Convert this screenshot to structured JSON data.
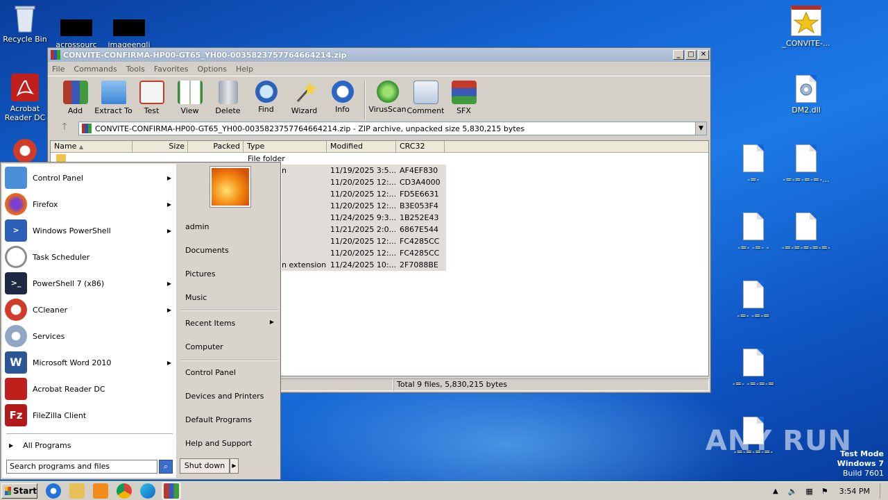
{
  "desktop": {
    "icons": [
      {
        "label": "Recycle Bin"
      },
      {
        "label": "acrossourc"
      },
      {
        "label": "imageengli"
      },
      {
        "label": "Acrobat Reader DC"
      },
      {
        "label": "_CONVITE-..."
      },
      {
        "label": "DM2.dll"
      },
      {
        "label": "-=-"
      },
      {
        "label": "-=-=-=-=-..."
      },
      {
        "label": "-=- -=- -"
      },
      {
        "label": "-=-=-=-=-=-"
      },
      {
        "label": "-=- -=-="
      },
      {
        "label": "-=- -=-=-="
      },
      {
        "label": "-=-=-=-=-"
      }
    ],
    "watermark": "ANY RUN",
    "test_mode": {
      "line1": "Test Mode",
      "line2": "Windows 7",
      "line3": "Build 7601"
    }
  },
  "winrar": {
    "title": "CONVITE-CONFIRMA-HP00-GT65_YH00-0035823757764664214.zip",
    "menu": [
      "File",
      "Commands",
      "Tools",
      "Favorites",
      "Options",
      "Help"
    ],
    "toolbar": [
      {
        "label": "Add",
        "icon": "add-icon"
      },
      {
        "label": "Extract To",
        "icon": "extract-folder-icon"
      },
      {
        "label": "Test",
        "icon": "test-clipboard-icon"
      },
      {
        "label": "View",
        "icon": "book-icon"
      },
      {
        "label": "Delete",
        "icon": "trash-icon"
      },
      {
        "label": "Find",
        "icon": "magnifier-icon"
      },
      {
        "label": "Wizard",
        "icon": "wand-icon"
      },
      {
        "label": "Info",
        "icon": "info-icon"
      },
      {
        "label": "VirusScan",
        "icon": "bug-icon"
      },
      {
        "label": "Comment",
        "icon": "comment-icon"
      },
      {
        "label": "SFX",
        "icon": "sfx-books-icon"
      }
    ],
    "address": "CONVITE-CONFIRMA-HP00-GT65_YH00-0035823757764664214.zip - ZIP archive, unpacked size 5,830,215 bytes",
    "columns": [
      "Name",
      "Size",
      "Packed",
      "Type",
      "Modified",
      "CRC32"
    ],
    "rows": [
      {
        "type": "File folder",
        "modified": "",
        "crc": ""
      },
      {
        "type": "n",
        "modified": "11/19/2025 3:5...",
        "crc": "AF4EF830"
      },
      {
        "type": "",
        "modified": "11/20/2025 12:...",
        "crc": "CD3A4000"
      },
      {
        "type": "",
        "modified": "11/20/2025 12:...",
        "crc": "FD5E6631"
      },
      {
        "type": "",
        "modified": "11/20/2025 12:...",
        "crc": "B3E053F4"
      },
      {
        "type": "",
        "modified": "11/24/2025 9:3...",
        "crc": "1B252E43"
      },
      {
        "type": "",
        "modified": "11/21/2025 2:0...",
        "crc": "6867E544"
      },
      {
        "type": "",
        "modified": "11/20/2025 12:...",
        "crc": "FC4285CC"
      },
      {
        "type": "",
        "modified": "11/20/2025 12:...",
        "crc": "FC4285CC"
      },
      {
        "type": "n extension",
        "modified": "11/24/2025 10:...",
        "crc": "2F7088BE"
      }
    ],
    "status_total": "Total 9 files, 5,830,215 bytes"
  },
  "start_menu": {
    "programs": [
      {
        "label": "Control Panel",
        "icon": "control-panel-icon",
        "color": "#4a8fd8",
        "arrow": true
      },
      {
        "label": "Firefox",
        "icon": "firefox-icon",
        "color": "#e8681c",
        "arrow": true
      },
      {
        "label": "Windows PowerShell",
        "icon": "powershell-icon",
        "color": "#2b5fb8",
        "arrow": true
      },
      {
        "label": "Task Scheduler",
        "icon": "clock-icon",
        "color": "#d9d9d9",
        "arrow": false
      },
      {
        "label": "PowerShell 7 (x86)",
        "icon": "powershell7-icon",
        "color": "#1e2a44",
        "arrow": true
      },
      {
        "label": "CCleaner",
        "icon": "ccleaner-icon",
        "color": "#d23b2a",
        "arrow": true
      },
      {
        "label": "Services",
        "icon": "services-gear-icon",
        "color": "#8fa7c4",
        "arrow": false
      },
      {
        "label": "Microsoft Word 2010",
        "icon": "word-icon",
        "color": "#2b5797",
        "arrow": true
      },
      {
        "label": "Acrobat Reader DC",
        "icon": "acrobat-icon",
        "color": "#c0201d",
        "arrow": false
      },
      {
        "label": "FileZilla Client",
        "icon": "filezilla-icon",
        "color": "#b3181a",
        "arrow": false
      }
    ],
    "all_programs": "All Programs",
    "search_placeholder": "Search programs and files",
    "right": {
      "user": "admin",
      "documents": "Documents",
      "pictures": "Pictures",
      "music": "Music",
      "recent": "Recent Items",
      "computer": "Computer",
      "control_panel": "Control Panel",
      "devices": "Devices and Printers",
      "defaults": "Default Programs",
      "help": "Help and Support"
    },
    "shutdown": "Shut down"
  },
  "taskbar": {
    "start": "Start",
    "clock": "3:54 PM"
  }
}
